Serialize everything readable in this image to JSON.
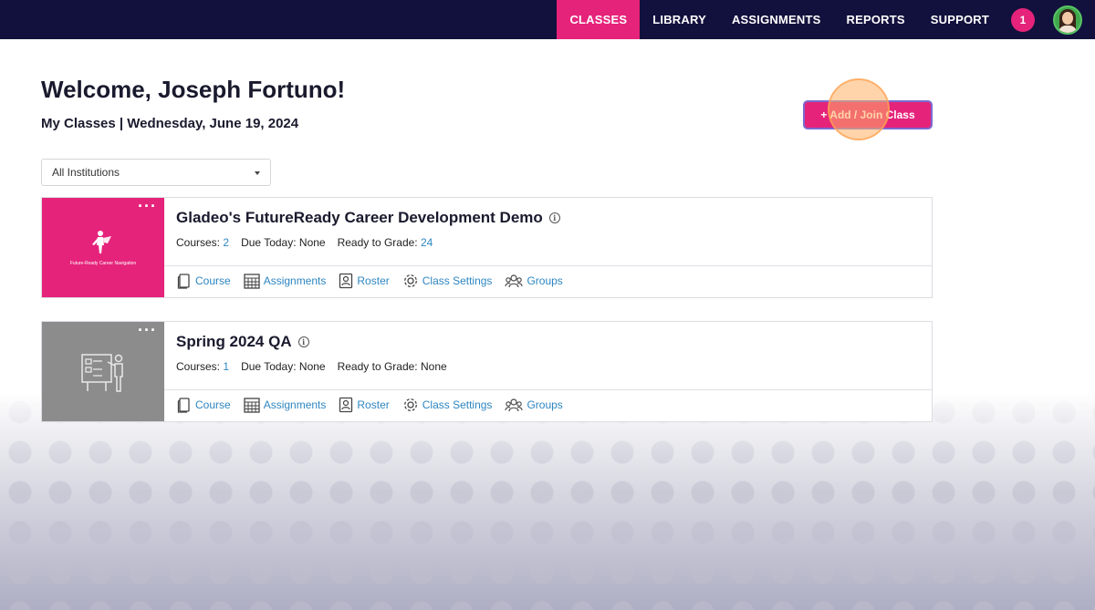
{
  "nav": {
    "items": [
      "CLASSES",
      "LIBRARY",
      "ASSIGNMENTS",
      "REPORTS",
      "SUPPORT"
    ],
    "active": "CLASSES",
    "notification_count": "1"
  },
  "header": {
    "welcome": "Welcome, Joseph Fortuno!",
    "subtitle": "My Classes | Wednesday, June 19, 2024",
    "add_button": "+ Add / Join Class"
  },
  "filter": {
    "selected": "All Institutions"
  },
  "classes": [
    {
      "title": "Gladeo's FutureReady Career Development Demo",
      "thumb_caption": "Future-Ready Career Navigation",
      "thumb_color": "#e5237a",
      "courses_label": "Courses:",
      "courses": "2",
      "due_label": "Due Today:",
      "due": "None",
      "grade_label": "Ready to Grade:",
      "grade": "24",
      "actions": [
        "Course",
        "Assignments",
        "Roster",
        "Class Settings",
        "Groups"
      ]
    },
    {
      "title": "Spring 2024 QA",
      "thumb_caption": "",
      "thumb_color": "#8c8c8c",
      "courses_label": "Courses:",
      "courses": "1",
      "due_label": "Due Today:",
      "due": "None",
      "grade_label": "Ready to Grade:",
      "grade": "None",
      "actions": [
        "Course",
        "Assignments",
        "Roster",
        "Class Settings",
        "Groups"
      ]
    }
  ],
  "colors": {
    "nav_bg": "#12113d",
    "accent": "#e5237a",
    "link": "#2e86c1"
  }
}
